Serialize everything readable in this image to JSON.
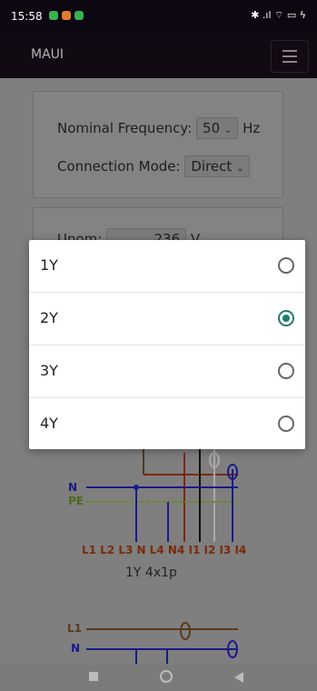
{
  "status_bar": {
    "time": "15:58",
    "right_text": "✱ .ıl ⌔ ▭ ϟ"
  },
  "app_bar": {
    "title": "MAUI"
  },
  "settings": {
    "freq_label": "Nominal Frequency:",
    "freq_value": "50",
    "freq_unit": "Hz",
    "mode_label": "Connection Mode:",
    "mode_value": "Direct"
  },
  "unom": {
    "label": "Unom:",
    "value": "236",
    "unit": "V"
  },
  "dialog": {
    "options": [
      {
        "label": "1Y",
        "selected": false
      },
      {
        "label": "2Y",
        "selected": true
      },
      {
        "label": "3Y",
        "selected": false
      },
      {
        "label": "4Y",
        "selected": false
      }
    ]
  },
  "diagram": {
    "wire_n": "N",
    "wire_pe": "PE",
    "terminal_labels": "L1 L2 L3 N L4 N4 I1 I2 I3 I4",
    "caption": "1Y 4x1p",
    "wire_l1": "L1",
    "wire_n2": "N"
  },
  "colors": {
    "accent": "#1f7b73",
    "appbar": "#120a12"
  }
}
